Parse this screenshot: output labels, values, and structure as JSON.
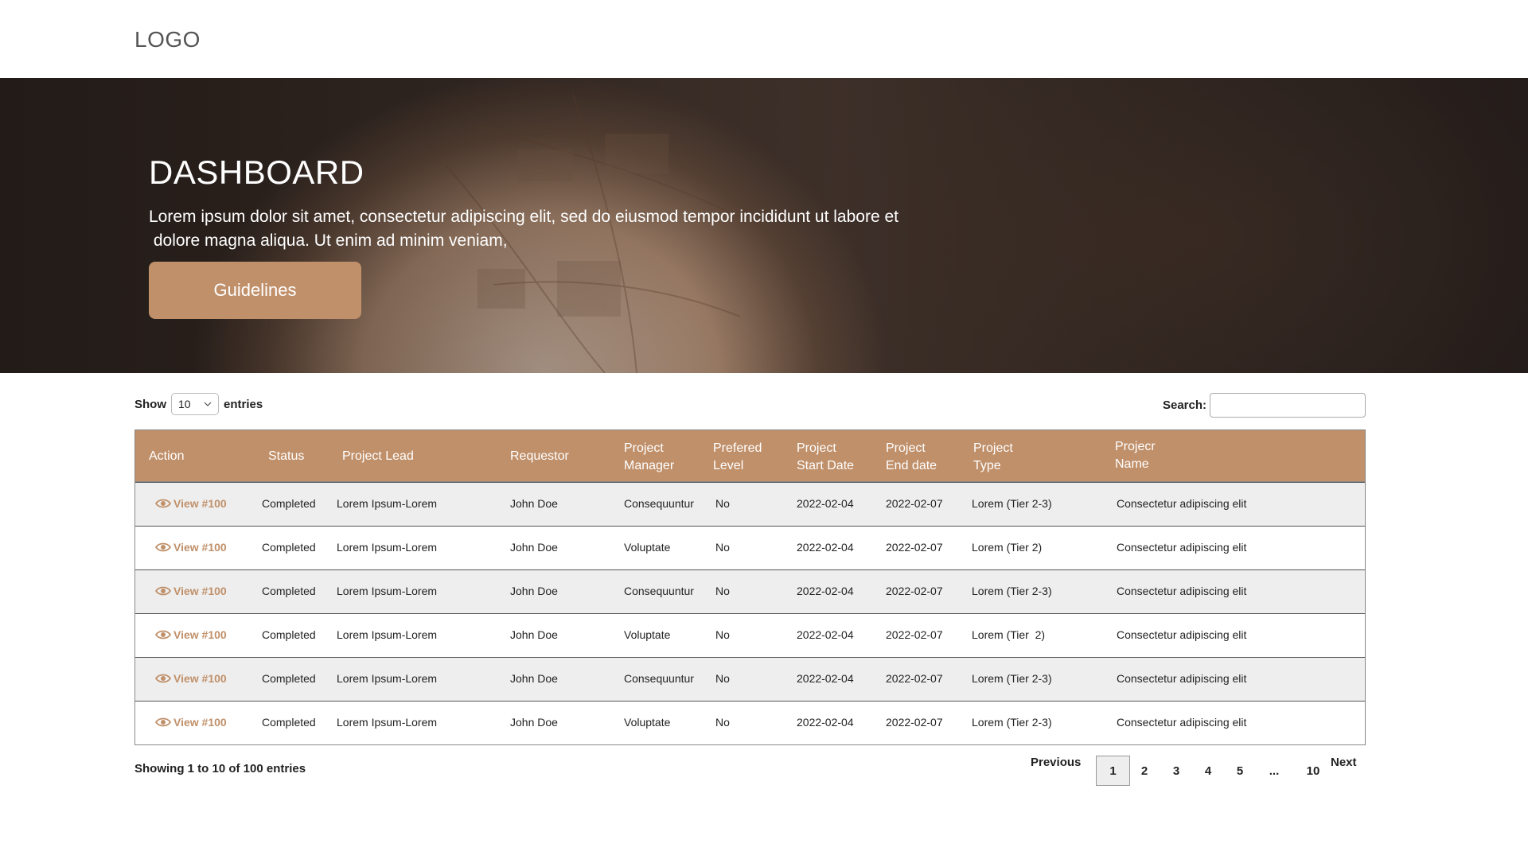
{
  "header": {
    "logo": "LOGO"
  },
  "hero": {
    "title": "DASHBOARD",
    "text_line1": "Lorem ipsum dolor sit amet, consectetur adipiscing elit, sed do eiusmod tempor incididunt ut labore et",
    "text_line2": " dolore magna aliqua. Ut enim ad minim veniam,",
    "button": "Guidelines"
  },
  "controls": {
    "show_label": "Show",
    "entries_value": "10",
    "entries_label": "entries",
    "search_label": "Search:",
    "search_value": ""
  },
  "table": {
    "headers": {
      "action": "Action",
      "status": "Status",
      "lead": "Project Lead",
      "requestor": "Requestor",
      "manager_1": "Project",
      "manager_2": "Manager",
      "level_1": "Prefered",
      "level_2": "Level",
      "start_1": "Project",
      "start_2": "Start Date",
      "end_1": "Project",
      "end_2": "End date",
      "type_1": "Project",
      "type_2": "Type",
      "name_1": "Projecr",
      "name_2": "Name"
    },
    "rows": [
      {
        "view": "View #100",
        "status": "Completed",
        "lead": "Lorem Ipsum-Lorem",
        "requestor": "John Doe",
        "manager": "Consequuntur",
        "level": "No",
        "start": "2022-02-04",
        "end": "2022-02-07",
        "type": "Lorem (Tier 2-3)",
        "name": "Consectetur adipiscing elit"
      },
      {
        "view": "View #100",
        "status": "Completed",
        "lead": "Lorem Ipsum-Lorem",
        "requestor": "John Doe",
        "manager": "Voluptate",
        "level": "No",
        "start": "2022-02-04",
        "end": "2022-02-07",
        "type": "Lorem (Tier 2)",
        "name": "Consectetur adipiscing elit"
      },
      {
        "view": "View #100",
        "status": "Completed",
        "lead": "Lorem Ipsum-Lorem",
        "requestor": "John Doe",
        "manager": "Consequuntur",
        "level": "No",
        "start": "2022-02-04",
        "end": "2022-02-07",
        "type": "Lorem (Tier 2-3)",
        "name": "Consectetur adipiscing elit"
      },
      {
        "view": "View #100",
        "status": "Completed",
        "lead": "Lorem Ipsum-Lorem",
        "requestor": "John Doe",
        "manager": "Voluptate",
        "level": "No",
        "start": "2022-02-04",
        "end": "2022-02-07",
        "type": "Lorem (Tier  2)",
        "name": "Consectetur adipiscing elit"
      },
      {
        "view": "View #100",
        "status": "Completed",
        "lead": "Lorem Ipsum-Lorem",
        "requestor": "John Doe",
        "manager": "Consequuntur",
        "level": "No",
        "start": "2022-02-04",
        "end": "2022-02-07",
        "type": "Lorem (Tier 2-3)",
        "name": "Consectetur adipiscing elit"
      },
      {
        "view": "View #100",
        "status": "Completed",
        "lead": "Lorem Ipsum-Lorem",
        "requestor": "John Doe",
        "manager": "Voluptate",
        "level": "No",
        "start": "2022-02-04",
        "end": "2022-02-07",
        "type": "Lorem (Tier 2-3)",
        "name": "Consectetur adipiscing elit"
      }
    ]
  },
  "footer": {
    "info": "Showing 1 to 10 of 100 entries",
    "previous": "Previous",
    "pages": [
      "1",
      "2",
      "3",
      "4",
      "5",
      "...",
      "10"
    ],
    "next": "Next",
    "current_page": "1"
  },
  "colors": {
    "accent": "#c0906a",
    "row_alt": "#eeeeee"
  }
}
